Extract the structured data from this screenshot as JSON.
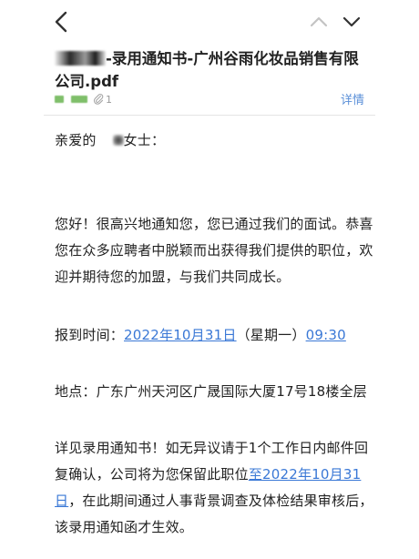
{
  "nav": {
    "back_icon": "chevron-left-icon",
    "prev_icon": "chevron-up-icon",
    "next_icon": "chevron-down-icon"
  },
  "mail": {
    "subject_suffix": "-录用通知书-广州谷雨化妆品销售有限公司.pdf",
    "attachment_count": "1",
    "details_label": "详情"
  },
  "letter": {
    "greeting_prefix": "亲爱的",
    "greeting_suffix": "女士：",
    "paragraph_1": "您好！很高兴地通知您，您已通过我们的面试。恭喜您在众多应聘者中脱颖而出获得我们提供的职位，欢迎并期待您的加盟，与我们共同成长。",
    "report_time_label": "报到时间：",
    "report_date": "2022年10月31日",
    "report_weekday": "（星期一）",
    "report_clock": "09:30",
    "location_label": "地点：",
    "location_value": "广东广州天河区广晟国际大厦17号18楼全层",
    "closing_part_1": "详见录用通知书！如无异议请于1个工作日内邮件回复确认，公司将为您保留此职位",
    "closing_link": "至2022年10月31日",
    "closing_part_2": "，在此期间通过人事背景调查及体检结果审核后，该录用通知函才生效。"
  },
  "colors": {
    "link": "#3a78d6",
    "details": "#5a8fd8",
    "redaction_green": "#7fbf6a"
  }
}
